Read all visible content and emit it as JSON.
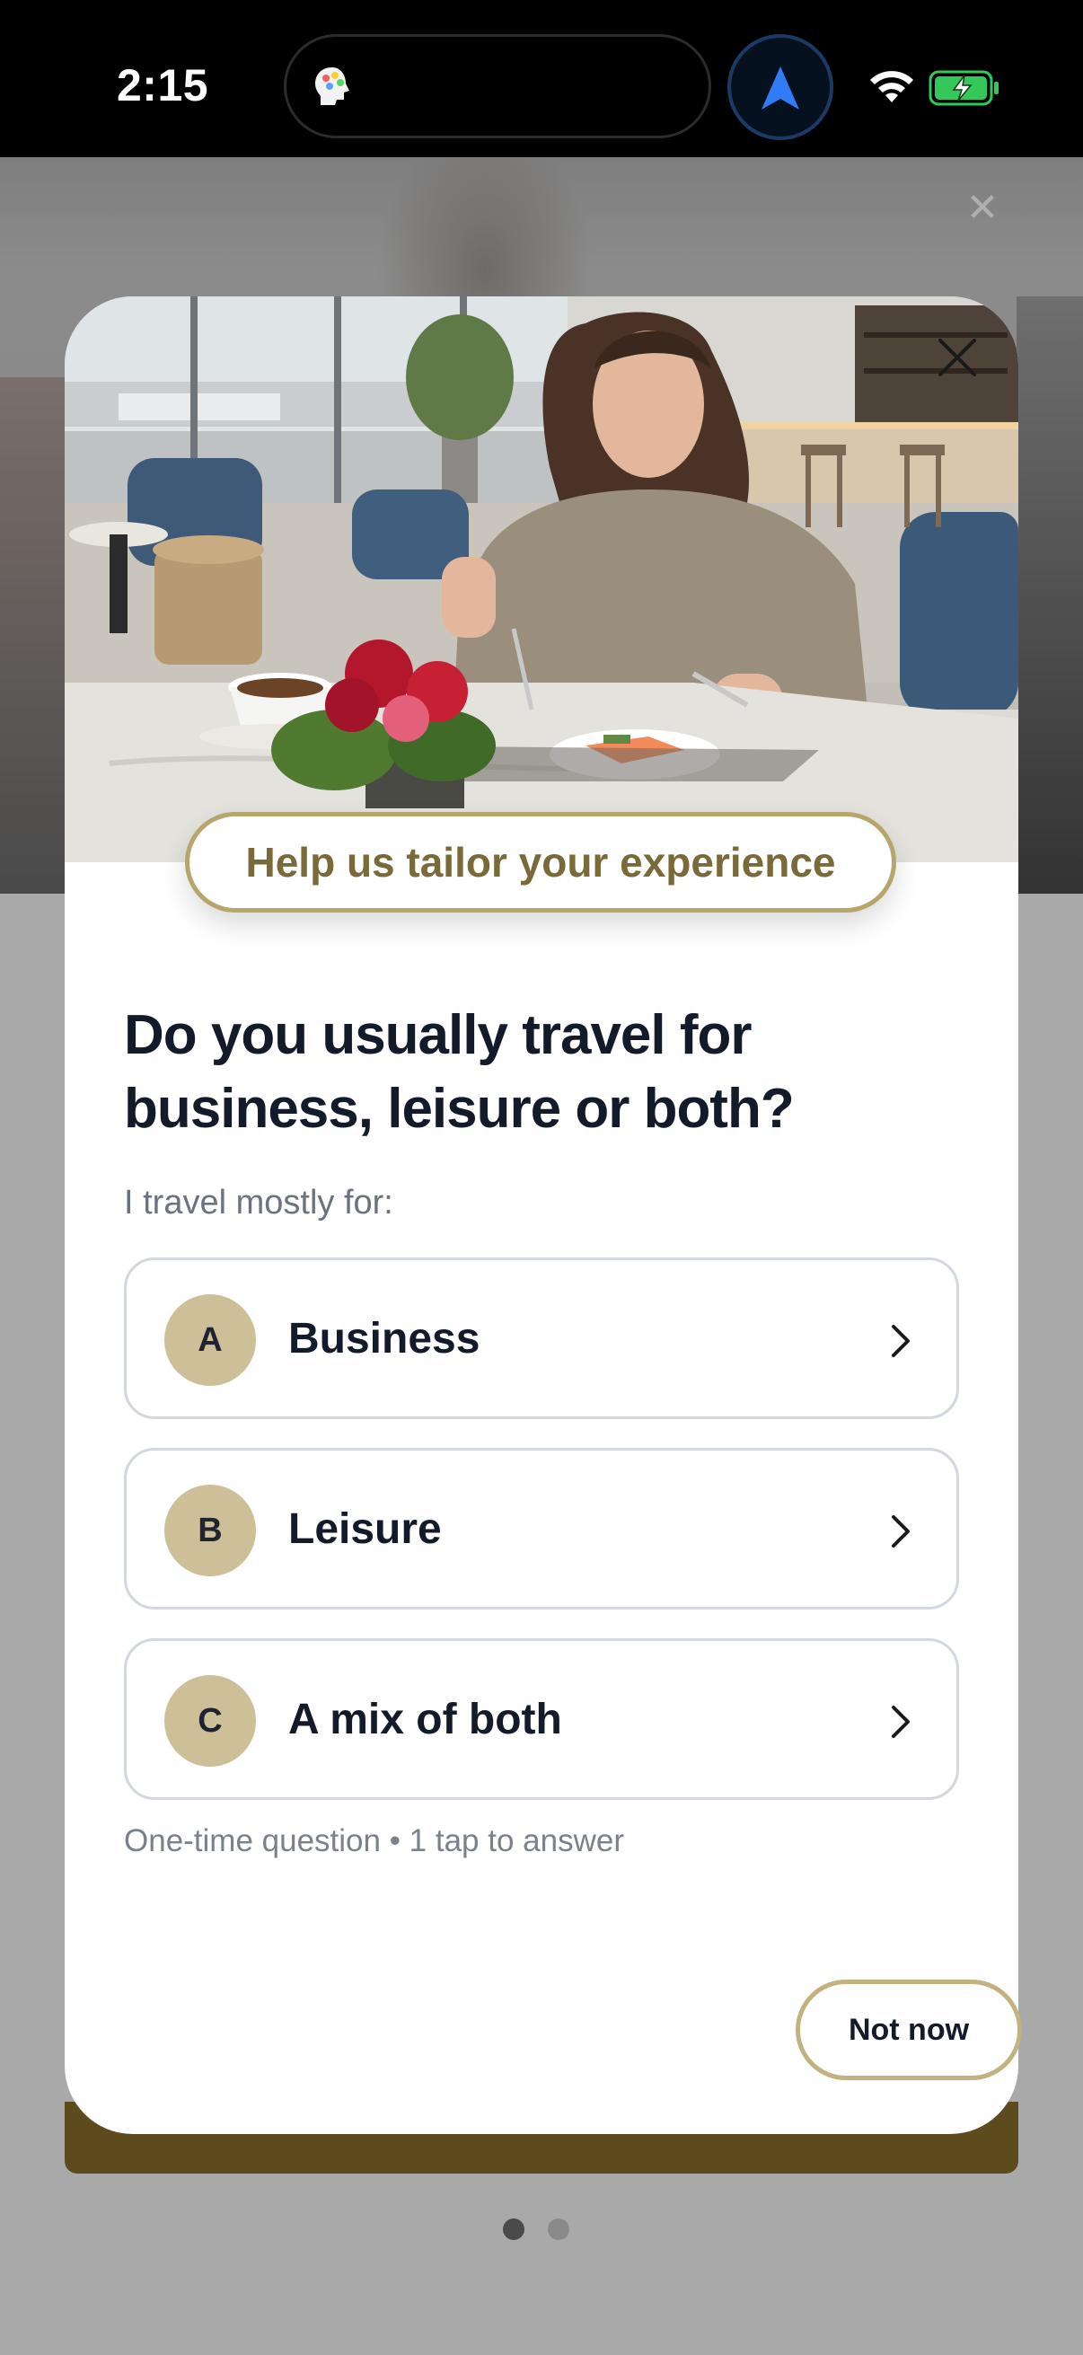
{
  "status_bar": {
    "time": "2:15",
    "icons": [
      "app-icon",
      "location-arrow-icon",
      "wifi-icon",
      "battery-charging-icon"
    ],
    "colors": {
      "location_arrow": "#2f7cf6",
      "battery": "#34c759"
    }
  },
  "modal": {
    "hero_description_icon": "lounge-photo",
    "close_icon": "close-icon",
    "tag": "Help us tailor your experience",
    "question": "Do you usually travel for business, leisure or both?",
    "subtitle": "I travel mostly for:",
    "options": [
      {
        "letter": "A",
        "label": "Business"
      },
      {
        "letter": "B",
        "label": "Leisure"
      },
      {
        "letter": "C",
        "label": "A mix of both"
      }
    ],
    "hint": "One-time question • 1 tap to answer",
    "not_now": "Not now"
  },
  "pagination": {
    "count": 2,
    "active": 1
  },
  "colors": {
    "accent_gold": "#b7a56b",
    "badge": "#cdbf98",
    "text_dark": "#131a2a",
    "muted": "#6b7280",
    "footer_bar": "#5d4a1d"
  }
}
